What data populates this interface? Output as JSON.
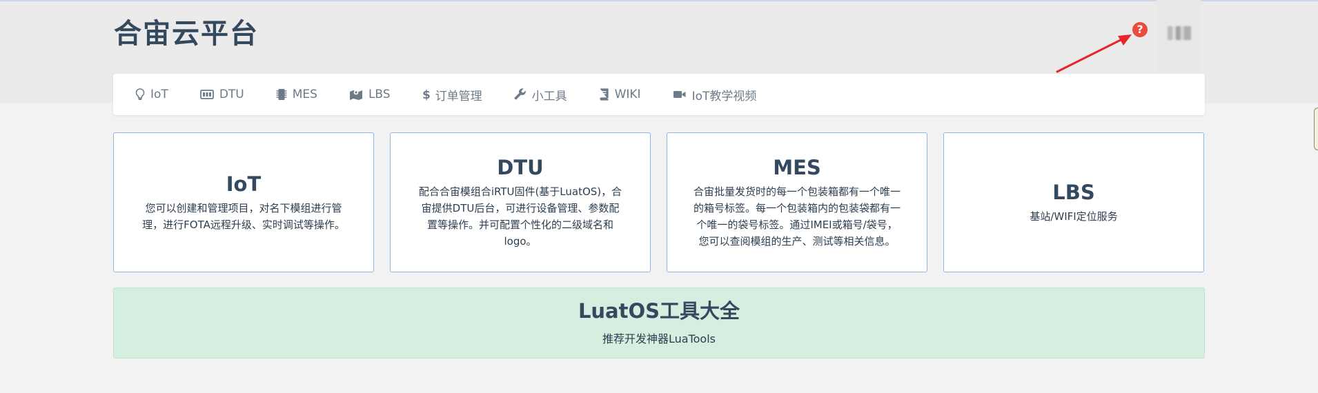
{
  "header": {
    "brand": "合宙云平台",
    "help_icon": "question-circle-icon",
    "help_color": "#e74c3c"
  },
  "nav": {
    "items": [
      {
        "label": "IoT",
        "icon": "lightbulb-icon"
      },
      {
        "label": "DTU",
        "icon": "device-icon"
      },
      {
        "label": "MES",
        "icon": "chip-icon"
      },
      {
        "label": "LBS",
        "icon": "map-icon"
      },
      {
        "label": "订单管理",
        "icon": "dollar-icon"
      },
      {
        "label": "小工具",
        "icon": "wrench-icon"
      },
      {
        "label": "WIKI",
        "icon": "book-icon"
      },
      {
        "label": "IoT教学视频",
        "icon": "video-icon"
      }
    ]
  },
  "cards": [
    {
      "title": "IoT",
      "desc": "您可以创建和管理项目，对名下模组进行管理，进行FOTA远程升级、实时调试等操作。"
    },
    {
      "title": "DTU",
      "desc": "配合合宙模组合iRTU固件(基于LuatOS)，合宙提供DTU后台，可进行设备管理、参数配置等操作。并可配置个性化的二级域名和logo。"
    },
    {
      "title": "MES",
      "desc": "合宙批量发货时的每一个包装箱都有一个唯一的箱号标签。每一个包装箱内的包装袋都有一个唯一的袋号标签。通过IMEI或箱号/袋号，您可以查阅模组的生产、测试等相关信息。"
    },
    {
      "title": "LBS",
      "desc": "基站/WIFI定位服务"
    }
  ],
  "banner": {
    "title": "LuatOS工具大全",
    "subtitle": "推荐开发神器LuaTools",
    "color": "#d4eee0"
  },
  "colors": {
    "card_border": "#8eb4e8",
    "text_dark": "#34495e",
    "annotation_arrow": "#e5262b"
  }
}
